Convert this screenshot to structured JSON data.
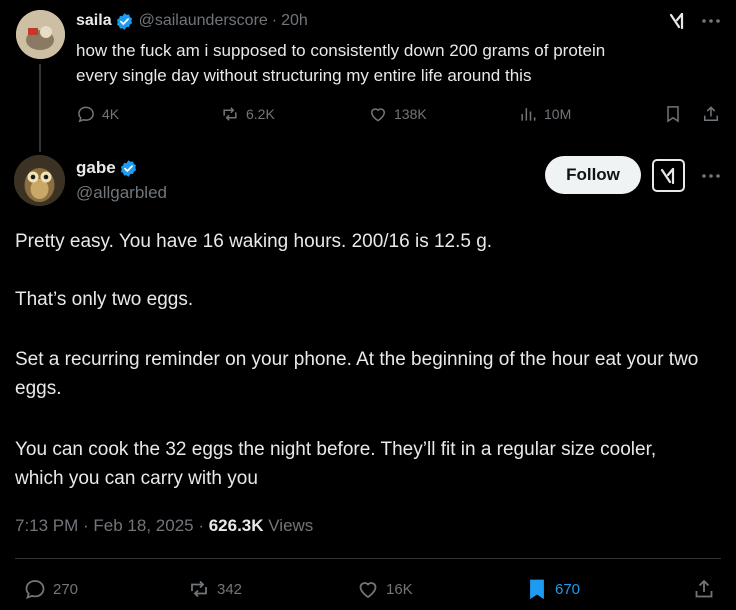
{
  "parent": {
    "display_name": "saila",
    "handle": "@sailaunderscore",
    "time": "20h",
    "text_line1": "how the fuck am i supposed to consistently down 200 grams of protein",
    "text_line2": "every single day without structuring my entire life around this",
    "replies": "4K",
    "reposts": "6.2K",
    "likes": "138K",
    "views": "10M"
  },
  "main": {
    "display_name": "gabe",
    "handle": "@allgarbled",
    "follow_label": "Follow",
    "paragraphs": [
      "Pretty easy. You have 16 waking hours. 200/16 is 12.5 g.",
      "That’s only two eggs.",
      "Set a recurring reminder on your phone. At the beginning of the hour eat your two eggs.",
      "You can cook the 32 eggs the night before. They’ll fit in a regular size cooler, which you can carry with you"
    ],
    "timestamp": "7:13 PM · Feb 18, 2025 · ",
    "view_count": "626.3K",
    "views_label": " Views",
    "replies": "270",
    "reposts": "342",
    "likes": "16K",
    "bookmarks": "670"
  },
  "colors": {
    "background": "#000000",
    "text": "#e7e9ea",
    "muted": "#71767b",
    "verified": "#1d9bf0",
    "bookmark_active": "#1d9bf0"
  },
  "icons": [
    "grok-icon",
    "more-icon",
    "reply-icon",
    "repost-icon",
    "like-icon",
    "views-icon",
    "bookmark-icon",
    "share-icon",
    "verified-badge-icon"
  ]
}
